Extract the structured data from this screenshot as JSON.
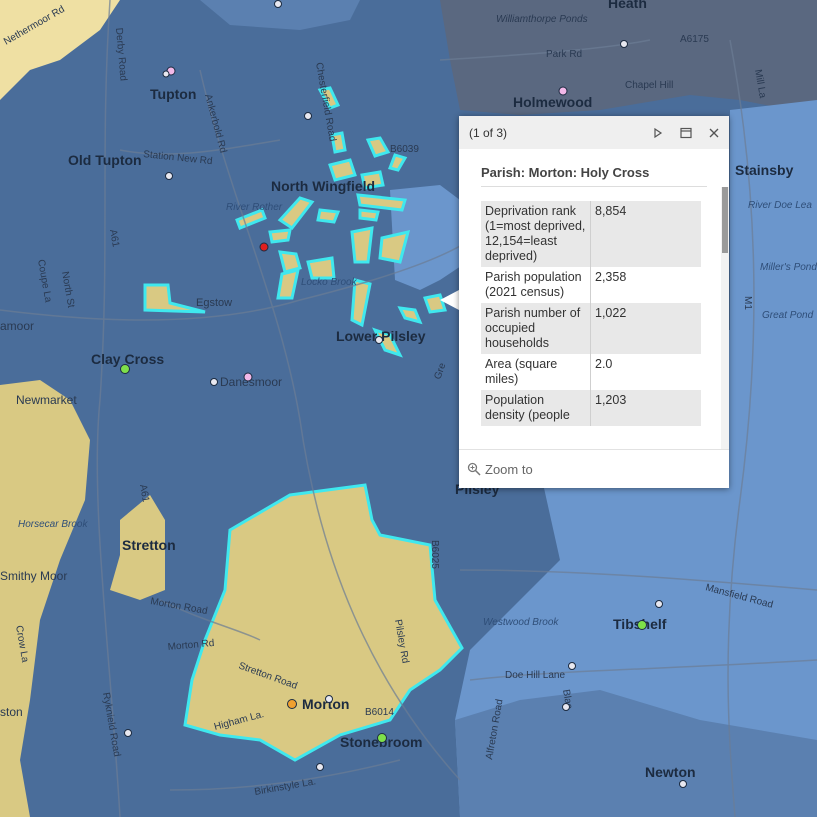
{
  "map": {
    "places": [
      {
        "id": "heath",
        "label": "Heath"
      },
      {
        "id": "tupton",
        "label": "Tupton"
      },
      {
        "id": "holmewood",
        "label": "Holmewood"
      },
      {
        "id": "old-tupton",
        "label": "Old Tupton"
      },
      {
        "id": "north-wingfield",
        "label": "North Wingfield"
      },
      {
        "id": "clay-cross",
        "label": "Clay Cross"
      },
      {
        "id": "lower-pilsley",
        "label": "Lower Pilsley"
      },
      {
        "id": "stretton",
        "label": "Stretton"
      },
      {
        "id": "morton",
        "label": "Morton"
      },
      {
        "id": "stonebroom",
        "label": "Stonebroom"
      },
      {
        "id": "tibshelf",
        "label": "Tibshelf"
      },
      {
        "id": "newton",
        "label": "Newton"
      },
      {
        "id": "stainsby",
        "label": "Stainsby"
      },
      {
        "id": "egstow",
        "label": "Egstow"
      },
      {
        "id": "newmarket",
        "label": "Newmarket"
      },
      {
        "id": "danesmoor",
        "label": "Danesmoor"
      },
      {
        "id": "smithy-moor",
        "label": "Smithy Moor"
      },
      {
        "id": "pilsley",
        "label": "Pilsley"
      },
      {
        "id": "amoor",
        "label": "amoor"
      }
    ],
    "roads": [
      {
        "id": "williamthorpe-ponds",
        "label": "Williamthorpe Ponds"
      },
      {
        "id": "park-rd",
        "label": "Park Rd"
      },
      {
        "id": "a6175",
        "label": "A6175"
      },
      {
        "id": "chapel-hill",
        "label": "Chapel Hill"
      },
      {
        "id": "mill-la",
        "label": "Mill La"
      },
      {
        "id": "nethermoor-rd",
        "label": "Nethermoor Rd"
      },
      {
        "id": "derby-road",
        "label": "Derby Road"
      },
      {
        "id": "ankerbold-rd",
        "label": "Ankerbold Rd"
      },
      {
        "id": "chesterfield-road",
        "label": "Chesterfield Road"
      },
      {
        "id": "station-new-rd",
        "label": "Station New Rd"
      },
      {
        "id": "b6039",
        "label": "B6039"
      },
      {
        "id": "a61-north",
        "label": "A61"
      },
      {
        "id": "a61-south",
        "label": "A61"
      },
      {
        "id": "m1",
        "label": "M1"
      },
      {
        "id": "north-st",
        "label": "North St"
      },
      {
        "id": "coupe-la",
        "label": "Coupe La"
      },
      {
        "id": "morton-road",
        "label": "Morton Road"
      },
      {
        "id": "morton-rd-2",
        "label": "Morton Rd"
      },
      {
        "id": "stretton-road",
        "label": "Stretton Road"
      },
      {
        "id": "pilsley-rd",
        "label": "Pilsley Rd"
      },
      {
        "id": "b6014",
        "label": "B6014"
      },
      {
        "id": "higham-la",
        "label": "Higham La."
      },
      {
        "id": "birkinstyle-la",
        "label": "Birkinstyle La."
      },
      {
        "id": "doe-hill-lane",
        "label": "Doe Hill Lane"
      },
      {
        "id": "mansfield-road",
        "label": "Mansfield Road"
      },
      {
        "id": "crow-la",
        "label": "Crow La"
      },
      {
        "id": "ryknield-road",
        "label": "Ryknield Road"
      },
      {
        "id": "alfreton-road",
        "label": "Alfreton Road"
      },
      {
        "id": "ston",
        "label": "ston"
      },
      {
        "id": "grea",
        "label": "Gre"
      },
      {
        "id": "blac",
        "label": "Blac"
      },
      {
        "id": "b6025",
        "label": "B6025"
      }
    ],
    "water": [
      {
        "id": "river-rother",
        "label": "River Rother"
      },
      {
        "id": "locko-brook",
        "label": "Locko Brook"
      },
      {
        "id": "horsecar-brook",
        "label": "Horsecar Brook"
      },
      {
        "id": "westwood-brook",
        "label": "Westwood Brook"
      },
      {
        "id": "river-doe-lea",
        "label": "River Doe Lea"
      },
      {
        "id": "millers-pond",
        "label": "Miller's Pond"
      },
      {
        "id": "great-pond",
        "label": "Great Pond"
      }
    ],
    "colors": {
      "dark_blue": "#4a6d9a",
      "mid_blue": "#5b80b0",
      "light_blue": "#6b96cc",
      "slate": "#5a6880",
      "yellow": "#d9c983",
      "pale_yellow": "#efe0a3",
      "highlight": "#3fe8ee",
      "marker_white": "#e8e8f0",
      "marker_pink": "#f2b8e8",
      "marker_green": "#7ee04a",
      "marker_red": "#e01e1e",
      "marker_orange": "#f0a030"
    }
  },
  "popup": {
    "counter": "(1 of 3)",
    "title": "Parish: Morton: Holy Cross",
    "rows": [
      {
        "label": "Deprivation rank (1=most deprived, 12,154=least deprived)",
        "value": "8,854"
      },
      {
        "label": "Parish population (2021 census)",
        "value": "2,358"
      },
      {
        "label": "Parish number of occupied households",
        "value": "1,022"
      },
      {
        "label": "Area (square miles)",
        "value": "2.0"
      },
      {
        "label": "Population density (people",
        "value": "1,203"
      }
    ],
    "zoom_label": "Zoom to",
    "icons": {
      "next": "play-next-icon",
      "dock": "dock-window-icon",
      "close": "close-icon",
      "zoom": "magnifier-icon"
    }
  }
}
